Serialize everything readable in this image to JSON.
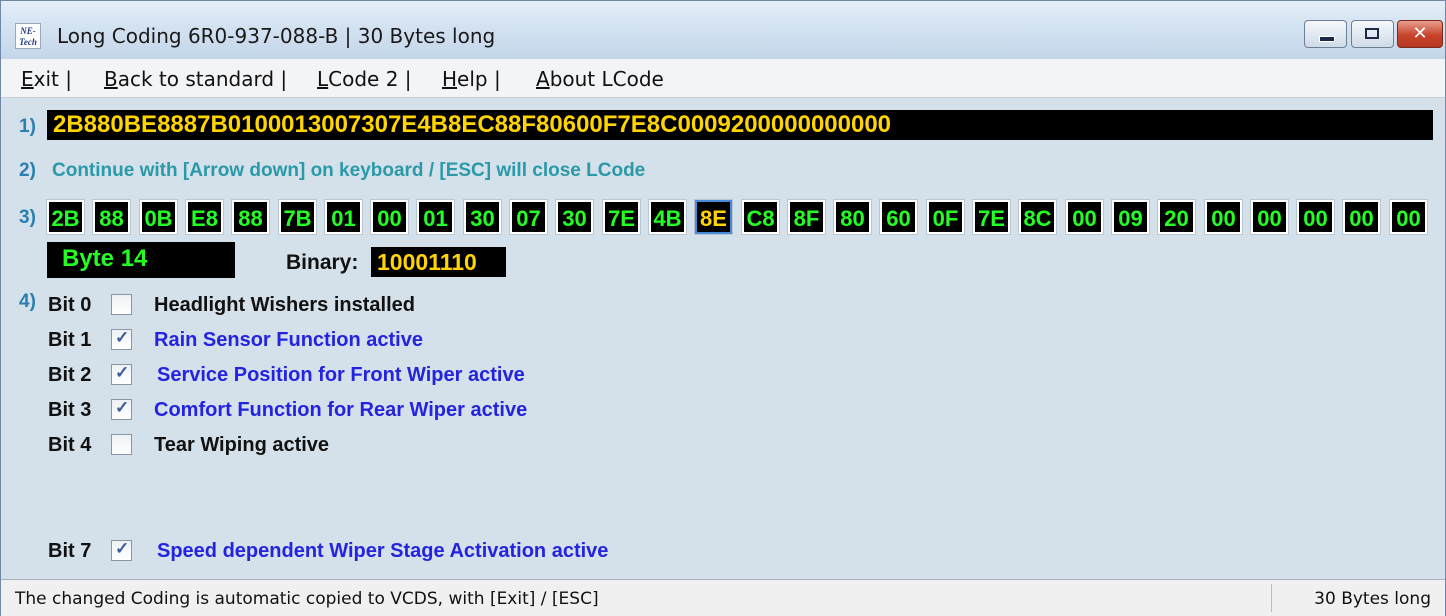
{
  "window": {
    "icon_text_1": "NE-",
    "icon_text_2": "Tech",
    "title": "Long Coding  6R0-937-088-B | 30 Bytes long",
    "close_glyph": "✕"
  },
  "menu": {
    "items": [
      {
        "label": "Exit |",
        "accel": "E"
      },
      {
        "label": "Back to standard |",
        "accel": "B"
      },
      {
        "label": "LCode 2 |",
        "accel": "L"
      },
      {
        "label": "Help |",
        "accel": "H"
      },
      {
        "label": "About LCode",
        "accel": "A"
      }
    ]
  },
  "step1": {
    "label": "1)",
    "coding": "2B880BE8887B0100013007307E4B8EC88F80600F7E8C0009200000000000"
  },
  "step2": {
    "label": "2)",
    "hint": "Continue with [Arrow down] on keyboard / [ESC] will close LCode"
  },
  "step3": {
    "label": "3)",
    "bytes": [
      "2B",
      "88",
      "0B",
      "E8",
      "88",
      "7B",
      "01",
      "00",
      "01",
      "30",
      "07",
      "30",
      "7E",
      "4B",
      "8E",
      "C8",
      "8F",
      "80",
      "60",
      "0F",
      "7E",
      "8C",
      "00",
      "09",
      "20",
      "00",
      "00",
      "00",
      "00",
      "00"
    ],
    "selected_index": 14
  },
  "byte_info": {
    "byte_label": "Byte 14",
    "binary_caption": "Binary:",
    "binary_value": "10001110"
  },
  "step4": {
    "label": "4)"
  },
  "bits": [
    {
      "label": "Bit 0",
      "checked": false,
      "desc": "Headlight Wishers installed"
    },
    {
      "label": "Bit 1",
      "checked": true,
      "desc": "Rain Sensor Function active"
    },
    {
      "label": "Bit 2",
      "checked": true,
      "desc": "Service Position for Front Wiper active"
    },
    {
      "label": "Bit 3",
      "checked": true,
      "desc": "Comfort Function for Rear Wiper active"
    },
    {
      "label": "Bit 4",
      "checked": false,
      "desc": "Tear Wiping active"
    },
    {
      "label": "Bit 7",
      "checked": true,
      "desc": "Speed dependent Wiper Stage Activation active"
    }
  ],
  "status": {
    "left": "The changed Coding is automatic copied to VCDS, with [Exit] / [ESC]",
    "right": "30 Bytes long"
  },
  "colors": {
    "byte_text": "#23ff23",
    "selected_byte_text": "#ffd400",
    "active_desc": "#2323e0"
  }
}
